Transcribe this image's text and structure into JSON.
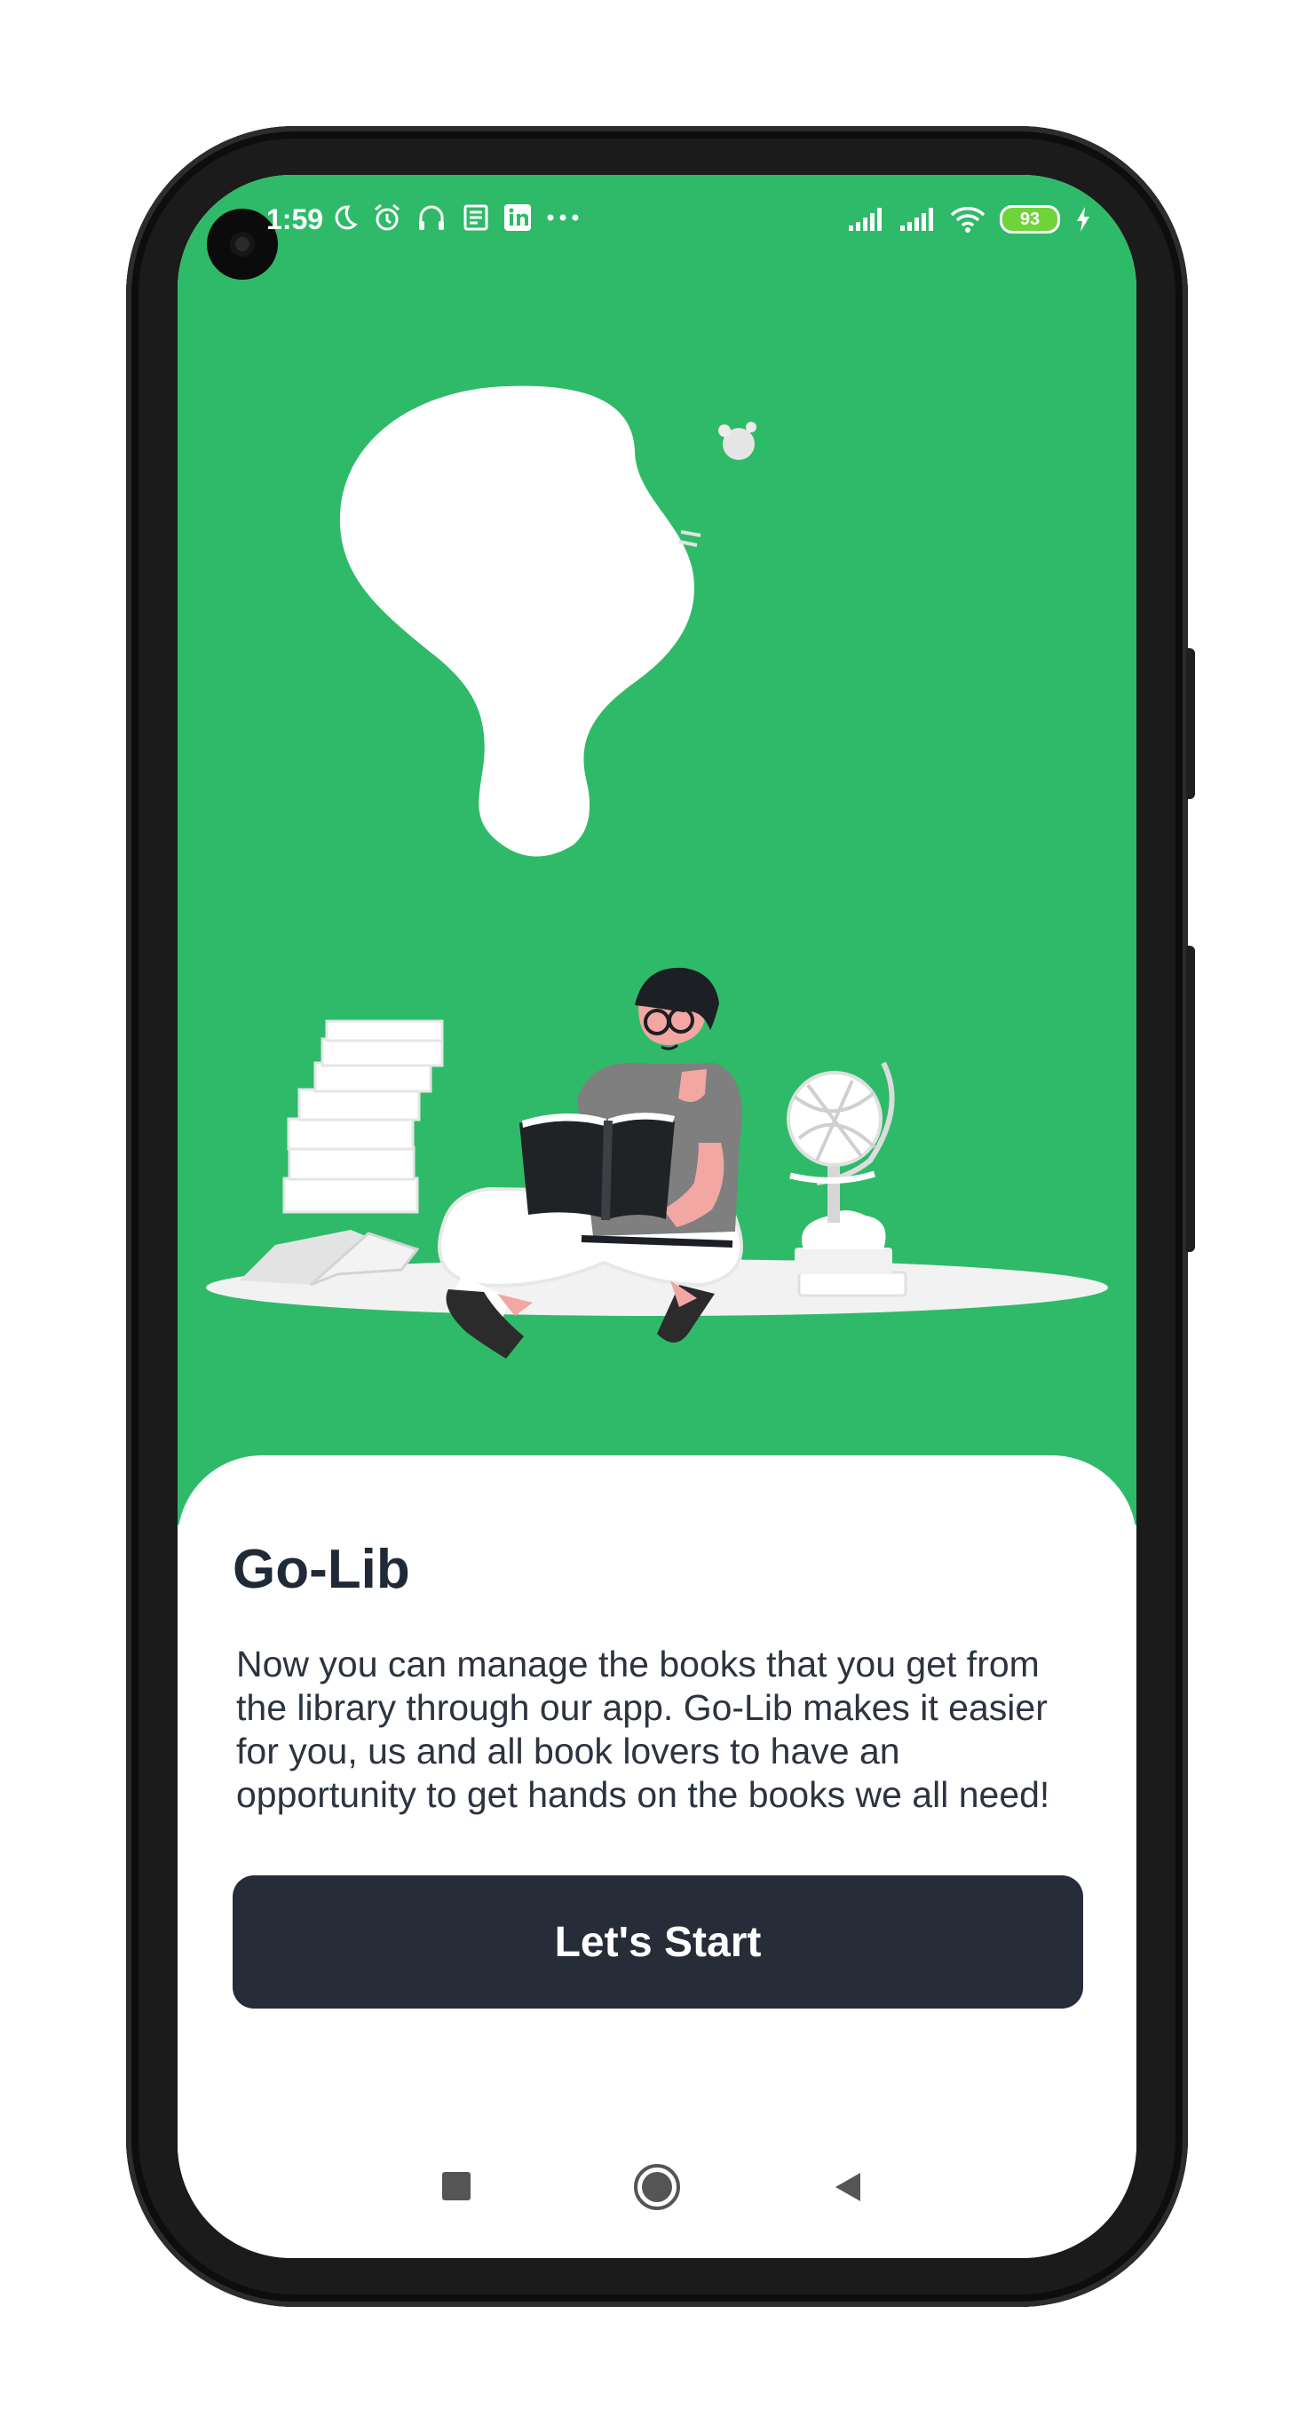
{
  "status_bar": {
    "time": "1:59",
    "battery": "93"
  },
  "app": {
    "title": "Go-Lib",
    "description": "Now you can manage the books that you get from the library through our app. Go-Lib makes it easier for you, us and all book lovers to have an opportunity to get hands on the books we all need!",
    "cta_label": "Let's Start"
  },
  "colors": {
    "hero_background": "#2fba69",
    "button_background": "#262c38"
  },
  "icons": [
    "moon-icon",
    "alarm-icon",
    "headphones-icon",
    "news-icon",
    "linkedin-icon",
    "more-icon",
    "signal-icon",
    "signal-icon",
    "wifi-icon",
    "battery-icon",
    "charging-icon",
    "recent-apps-icon",
    "home-icon",
    "back-icon"
  ]
}
